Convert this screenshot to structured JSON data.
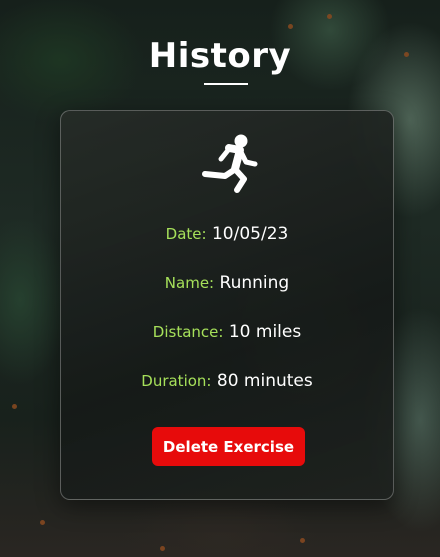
{
  "page": {
    "title": "History"
  },
  "exercise": {
    "icon": "running-person-icon",
    "fields": [
      {
        "label": "Date:",
        "value": "10/05/23"
      },
      {
        "label": "Name:",
        "value": "Running"
      },
      {
        "label": "Distance:",
        "value": "10 miles"
      },
      {
        "label": "Duration:",
        "value": "80 minutes"
      }
    ],
    "delete_label": "Delete Exercise"
  },
  "colors": {
    "label_accent": "#a6e05a",
    "delete_button": "#e70b0b",
    "text": "#ffffff"
  }
}
